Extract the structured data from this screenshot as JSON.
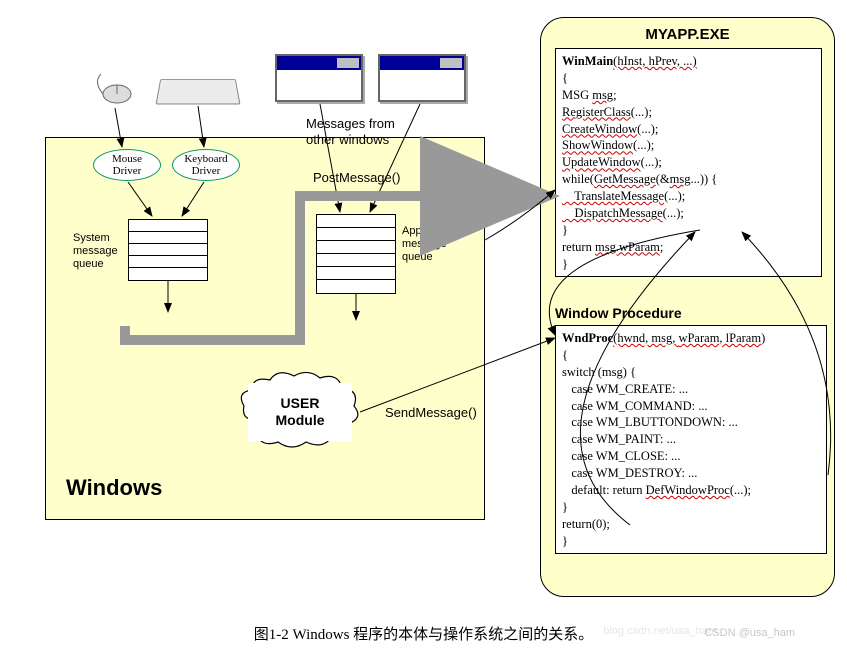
{
  "windows_label": "Windows",
  "mouse_driver": "Mouse\nDriver",
  "keyboard_driver": "Keyboard\nDriver",
  "sys_queue_label": "System\nmessage\nqueue",
  "app_queue_label": "Application\nmessage\nqueue",
  "user_module": "USER\nModule",
  "post_message": "PostMessage()",
  "send_message": "SendMessage()",
  "msg_from": "Messages from\nother windows",
  "myapp": {
    "title": "MYAPP.EXE",
    "winmain": {
      "sig_fn": "WinMain",
      "sig_rest": "(hInst, hPrev, ...)",
      "brace_open": "{",
      "l1a": "MSG ",
      "l1b": "msg",
      "l1c": ";",
      "l2a": "RegisterClass",
      "l2b": "(...);",
      "l3a": "CreateWindow",
      "l3b": "(...);",
      "l4a": "ShowWindow",
      "l4b": "(...);",
      "l5a": "UpdateWindow",
      "l5b": "(...);",
      "l6a": "while(",
      "l6b": "GetMessage",
      "l6c": "(&",
      "l6d": "msg",
      "l6e": "...)) {",
      "l7a": "    TranslateMessage",
      "l7b": "(...);",
      "l8a": "    DispatchMessage",
      "l8b": "(...);",
      "l9": "}",
      "l10a": "return ",
      "l10b": "msg.wParam",
      "l10c": ";",
      "brace_close": "}"
    },
    "wndproc_label": "Window Procedure",
    "wndproc": {
      "sig_fn": "WndProc",
      "sig_rest1": "(hwnd, msg, ",
      "sig_rest2": "wParam, lParam",
      "sig_rest3": ")",
      "brace_open": "{",
      "l1": "switch (msg) {",
      "l2": "   case WM_CREATE: ...",
      "l3": "   case WM_COMMAND: ...",
      "l4": "   case WM_LBUTTONDOWN: ...",
      "l5": "   case WM_PAINT: ...",
      "l6": "   case WM_CLOSE: ...",
      "l7": "   case WM_DESTROY: ...",
      "l8a": "   default: return ",
      "l8b": "DefWindowProc",
      "l8c": "(...);",
      "l9": "}",
      "l10": "return(0);",
      "brace_close": "}"
    }
  },
  "caption": "图1-2 Windows 程序的本体与操作系统之间的关系。",
  "watermark": "CSDN @usa_ham",
  "watermark2": "blog.csdn.net/usa_ham"
}
